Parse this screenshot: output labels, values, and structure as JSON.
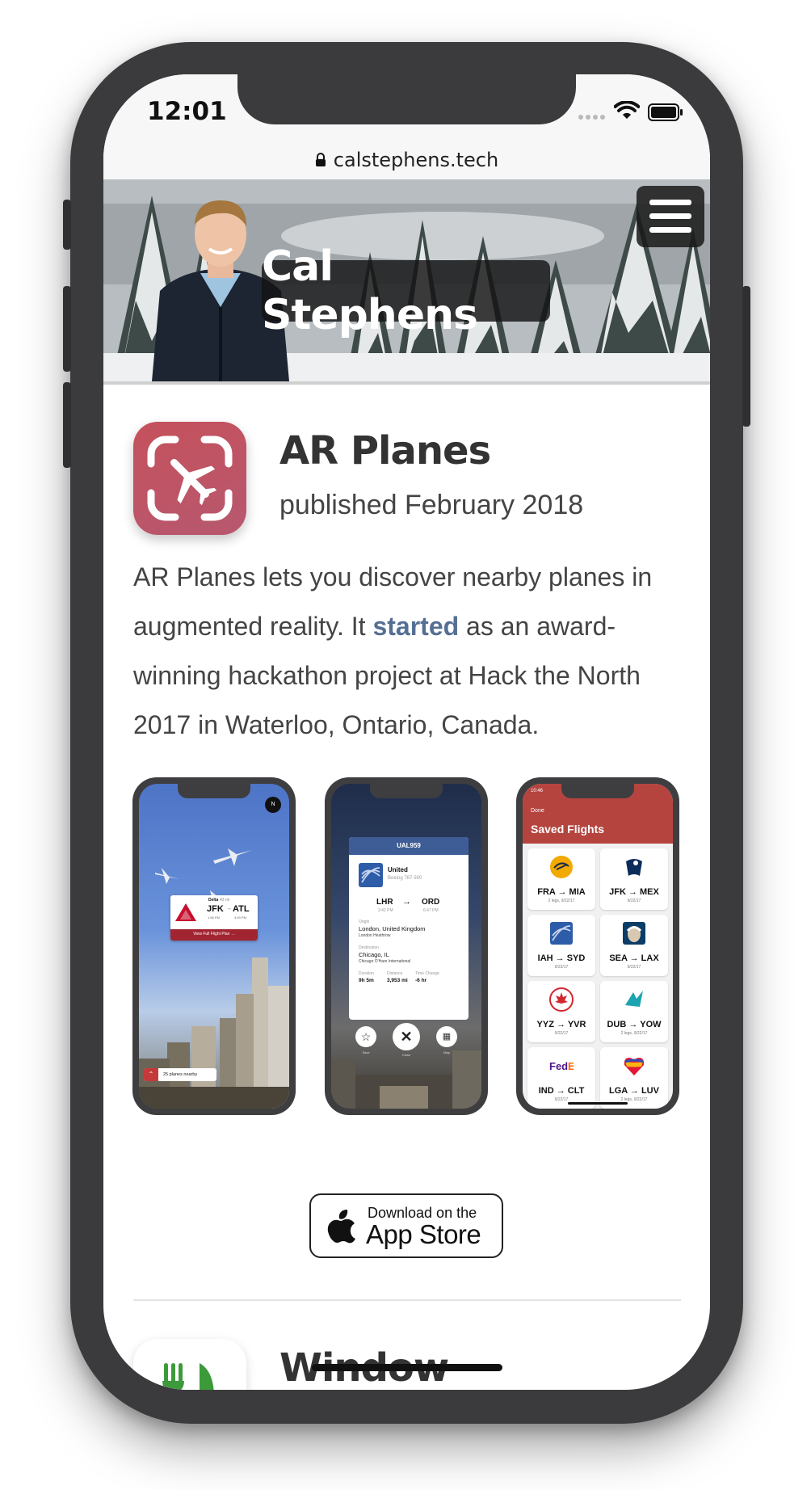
{
  "status_bar": {
    "time": "12:01"
  },
  "browser": {
    "url": "calstephens.tech"
  },
  "header": {
    "name": "Cal Stephens"
  },
  "app": {
    "title": "AR Planes",
    "published": "published February 2018",
    "description_before": "AR Planes lets you discover nearby planes in augmented reality. It ",
    "description_link": "started",
    "description_after": " as an award-winning hackathon project at Hack the North 2017 in Waterloo, Ontario, Canada."
  },
  "screenshot1": {
    "airline": "Delta",
    "distance": "43 mi",
    "from": "JFK",
    "to": "ATL",
    "depart": "1:56 PM",
    "arrive": "3:49 PM",
    "cta": "View Full Flight Plan →",
    "nearby": "25 planes nearby"
  },
  "screenshot2": {
    "flight": "UAL959",
    "airline": "United",
    "aircraft": "Boeing 767-300",
    "from": "LHR",
    "to": "ORD",
    "depart": "3:42 PM",
    "arrive": "6:47 PM",
    "origin_label": "Origin",
    "origin": "London, United Kingdom",
    "origin_airport": "London Heathrow",
    "destination_label": "Destination",
    "destination": "Chicago, IL",
    "destination_airport": "Chicago O'Hare International",
    "duration_label": "Duration",
    "duration": "9h 5m",
    "distance_label": "Distance",
    "distance": "3,953 mi",
    "time_change_label": "Time Change",
    "time_change": "-6 hr",
    "save_label": "Save",
    "close_label": "Close",
    "map_label": "Map"
  },
  "screenshot3": {
    "time": "10:46",
    "done": "Done",
    "title": "Saved Flights",
    "flights": [
      {
        "route": "FRA → MIA",
        "sub": "2 legs, 9/22/17",
        "logo": "lufthansa-logo"
      },
      {
        "route": "JFK → MEX",
        "sub": "9/22/17",
        "logo": "aeromexico-logo"
      },
      {
        "route": "IAH → SYD",
        "sub": "9/22/17",
        "logo": "united-logo"
      },
      {
        "route": "SEA → LAX",
        "sub": "9/22/17",
        "logo": "alaska-logo"
      },
      {
        "route": "YYZ → YVR",
        "sub": "9/22/17",
        "logo": "air-canada-logo"
      },
      {
        "route": "DUB → YOW",
        "sub": "2 legs, 9/22/17",
        "logo": "westjet-logo"
      },
      {
        "route": "IND → CLT",
        "sub": "9/22/17",
        "logo": "fedex-logo"
      },
      {
        "route": "LGA → LUV",
        "sub": "2 legs, 9/22/17",
        "logo": "southwest-logo"
      }
    ]
  },
  "store_badge": {
    "small": "Download on the",
    "big": "App Store"
  },
  "next_app": {
    "title": "Window"
  },
  "colors": {
    "accent": "#556f93",
    "icon_red": "#c5515c",
    "saved_header": "#b5443f",
    "united_blue": "#3a5a9c",
    "delta_red": "#c8102e"
  }
}
